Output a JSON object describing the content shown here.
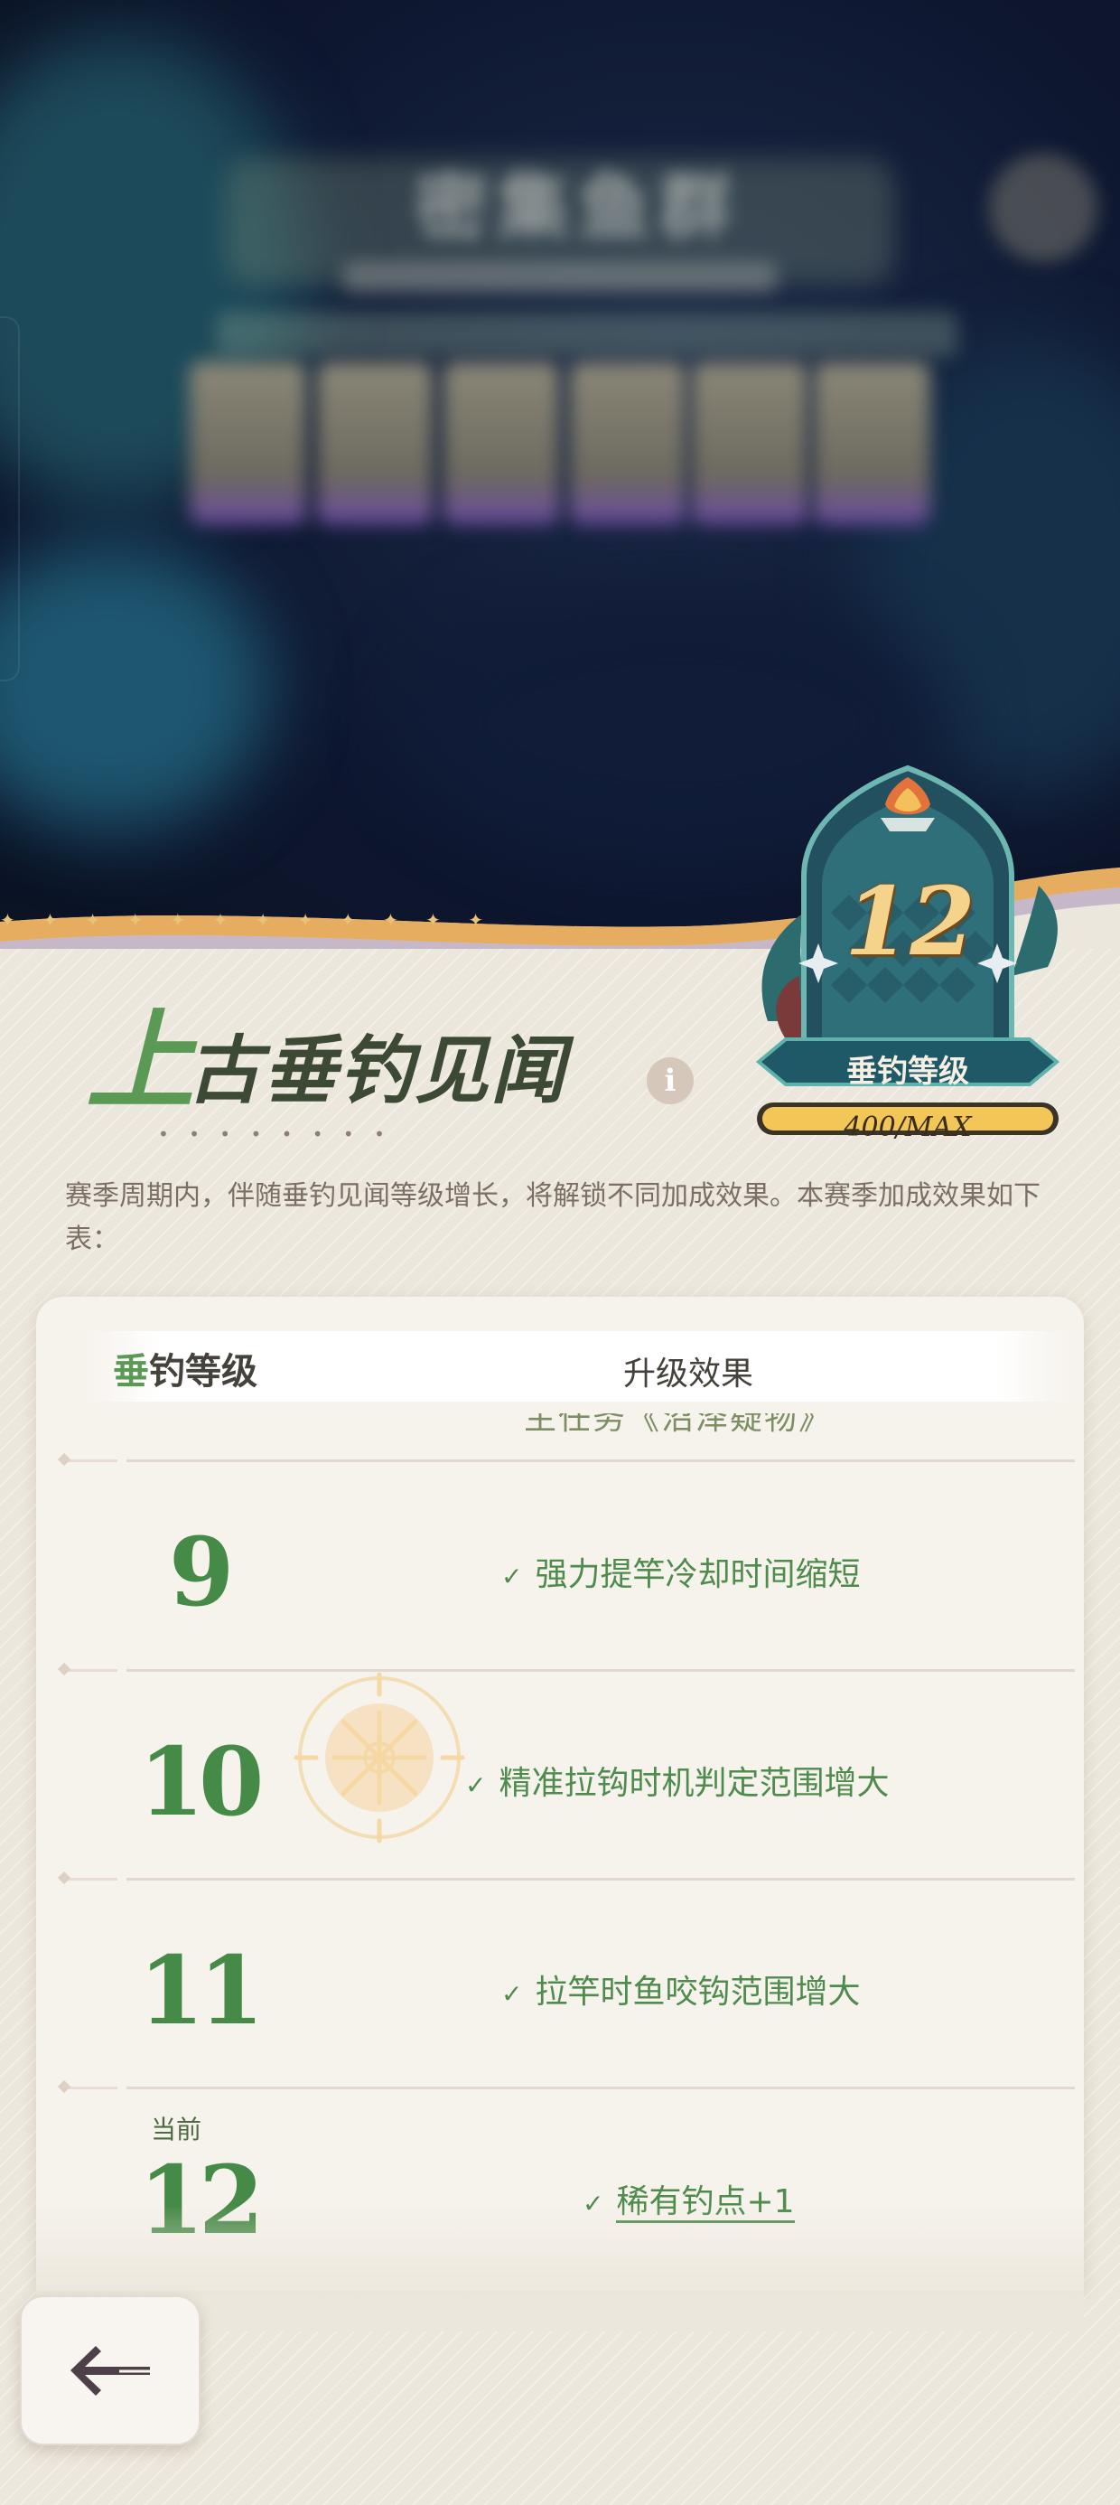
{
  "background": {
    "blurred_title": "密集鱼群"
  },
  "header": {
    "title_first_char": "上",
    "title_rest": "古垂钓见闻",
    "info_icon": "i",
    "dots": "• • • • • • • •"
  },
  "badge": {
    "level": "12",
    "label": "垂钓等级",
    "progress": "400/MAX"
  },
  "description": "赛季周期内，伴随垂钓见闻等级增长，将解锁不同加成效果。本赛季加成效果如下表：",
  "table": {
    "header_level_first": "垂",
    "header_level_rest": "钓等级",
    "header_effect": "升级效果",
    "cut_off_text": "主任务《沼泽疑物》",
    "current_label": "当前",
    "rows": [
      {
        "level": "9",
        "effect": "强力提竿冷却时间缩短"
      },
      {
        "level": "10",
        "effect": "精准拉钩时机判定范围增大"
      },
      {
        "level": "11",
        "effect": "拉竿时鱼咬钩范围增大"
      },
      {
        "level": "12",
        "effect": "稀有钓点+1"
      }
    ]
  },
  "check_glyph": "✓",
  "colors": {
    "accent_green": "#5b9a55",
    "panel_bg": "#ece7dc",
    "badge_teal": "#2f6f7a",
    "badge_gold": "#f5d38a"
  },
  "icons": {
    "back": "back-arrow-icon",
    "info": "info-icon",
    "compass": "compass-icon"
  }
}
